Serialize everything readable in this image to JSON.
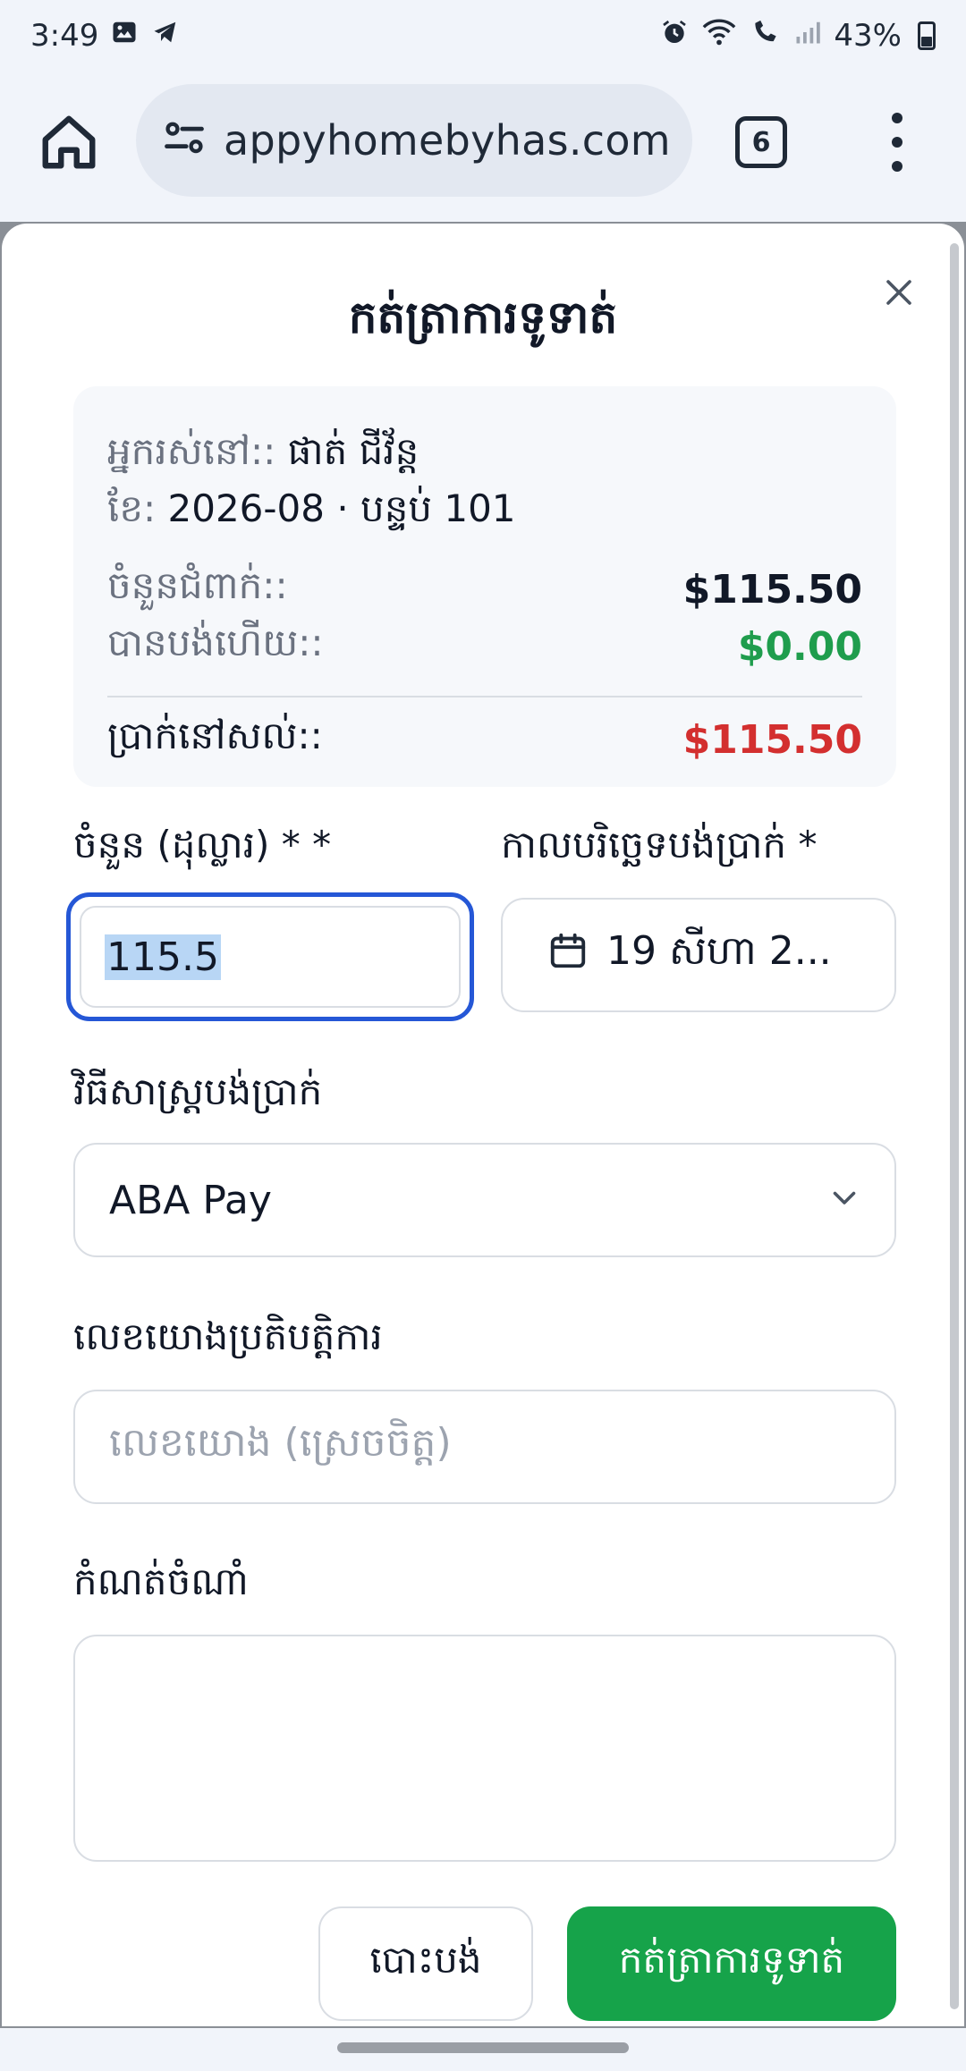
{
  "status_bar": {
    "time": "3:49",
    "battery": "43%"
  },
  "browser": {
    "url": "appyhomebyhas.com",
    "tab_count": "6"
  },
  "modal": {
    "title": "កត់ត្រាការទូទាត់",
    "summary": {
      "tenant_label": "អ្នករស់នៅ::",
      "tenant_name": "ផាត់ ជីវ័ន្ត",
      "month_label": "ខែ:",
      "month_value": "2026-08 · បន្ទប់ 101",
      "due_label": "ចំនួនជំពាក់::",
      "due_amount": "$115.50",
      "paid_label": "បានបង់ហើយ::",
      "paid_amount": "$0.00",
      "remaining_label": "ប្រាក់នៅសល់::",
      "remaining_amount": "$115.50"
    },
    "amount_label": "ចំនួន (ដុល្លារ) * *",
    "amount_value": "115.5",
    "date_label": "កាលបរិច្ឆេទបង់ប្រាក់ *",
    "date_value": "19 សីហា 2...",
    "method_label": "វិធីសាស្ត្របង់ប្រាក់",
    "method_value": "ABA Pay",
    "ref_label": "លេខយោងប្រតិបត្តិការ",
    "ref_placeholder": "លេខយោង (ស្រេចចិត្ត)",
    "note_label": "កំណត់ចំណាំ",
    "note_value": "",
    "cancel_label": "បោះបង់",
    "submit_label": "កត់ត្រាការទូទាត់"
  },
  "colors": {
    "accent_blue": "#2557d6",
    "success_green": "#16a34a",
    "danger_red": "#d32f2f",
    "paid_green": "#1f9d4d"
  }
}
